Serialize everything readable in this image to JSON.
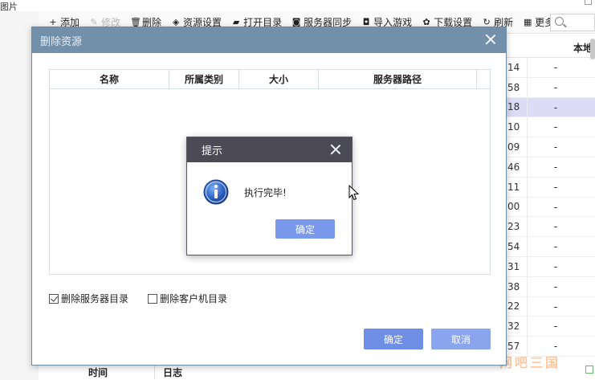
{
  "window": {
    "corner_label": "图片"
  },
  "toolbar": {
    "items": [
      {
        "icon": "plus-icon",
        "glyph": "+",
        "label": "添加",
        "enabled": true
      },
      {
        "icon": "pencil-icon",
        "glyph": "✎",
        "label": "修改",
        "enabled": false
      },
      {
        "icon": "trash-icon",
        "glyph": "🗑",
        "label": "删除",
        "enabled": true
      },
      {
        "icon": "layers-icon",
        "glyph": "◈",
        "label": "资源设置",
        "enabled": true
      },
      {
        "icon": "folder-icon",
        "glyph": "▰",
        "label": "打开目录",
        "enabled": true
      },
      {
        "icon": "sync-icon",
        "glyph": "◙",
        "label": "服务器同步",
        "enabled": true
      },
      {
        "icon": "gamepad-icon",
        "glyph": "◘",
        "label": "导入游戏",
        "enabled": true
      },
      {
        "icon": "gear-icon",
        "glyph": "✿",
        "label": "下载设置",
        "enabled": true
      },
      {
        "icon": "refresh-icon",
        "glyph": "↻",
        "label": "刷新",
        "enabled": true
      },
      {
        "icon": "grid-icon",
        "glyph": "▦",
        "label": "更多",
        "enabled": true
      }
    ]
  },
  "background_table": {
    "header": "本地更新时间",
    "rows": [
      {
        "time_suffix": "14",
        "value": "-",
        "selected": false
      },
      {
        "time_suffix": "58",
        "value": "-",
        "selected": false
      },
      {
        "time_suffix": "18",
        "value": "-",
        "selected": true
      },
      {
        "time_suffix": "10",
        "value": "-",
        "selected": false
      },
      {
        "time_suffix": "09",
        "value": "-",
        "selected": false
      },
      {
        "time_suffix": "46",
        "value": "-",
        "selected": false
      },
      {
        "time_suffix": "11",
        "value": "-",
        "selected": false
      },
      {
        "time_suffix": "00",
        "value": "-",
        "selected": false
      },
      {
        "time_suffix": "23",
        "value": "-",
        "selected": false
      },
      {
        "time_suffix": "54",
        "value": "-",
        "selected": false
      },
      {
        "time_suffix": "31",
        "value": "-",
        "selected": false
      },
      {
        "time_suffix": "38",
        "value": "-",
        "selected": false
      },
      {
        "time_suffix": "22",
        "value": "-",
        "selected": false
      },
      {
        "time_suffix": "32",
        "value": "-",
        "selected": false
      },
      {
        "time_suffix": "57",
        "value": "-",
        "selected": false
      }
    ]
  },
  "log_panel": {
    "col_time": "时间",
    "col_log": "日志"
  },
  "watermark": "网吧三国",
  "delete_dialog": {
    "title": "删除资源",
    "columns": [
      "名称",
      "所属类别",
      "大小",
      "服务器路径"
    ],
    "options": [
      {
        "label": "删除服务器目录",
        "checked": true
      },
      {
        "label": "删除客户机目录",
        "checked": false
      }
    ],
    "ok_label": "确定",
    "cancel_label": "取消"
  },
  "tip_dialog": {
    "title": "提示",
    "message": "执行完毕!",
    "ok_label": "确定"
  },
  "colors": {
    "dialog_title_bar": "#7390ab",
    "tip_title_bar": "#4b4a55",
    "primary_button": "#6f8fe6",
    "selected_row": "#dcdcf6"
  }
}
